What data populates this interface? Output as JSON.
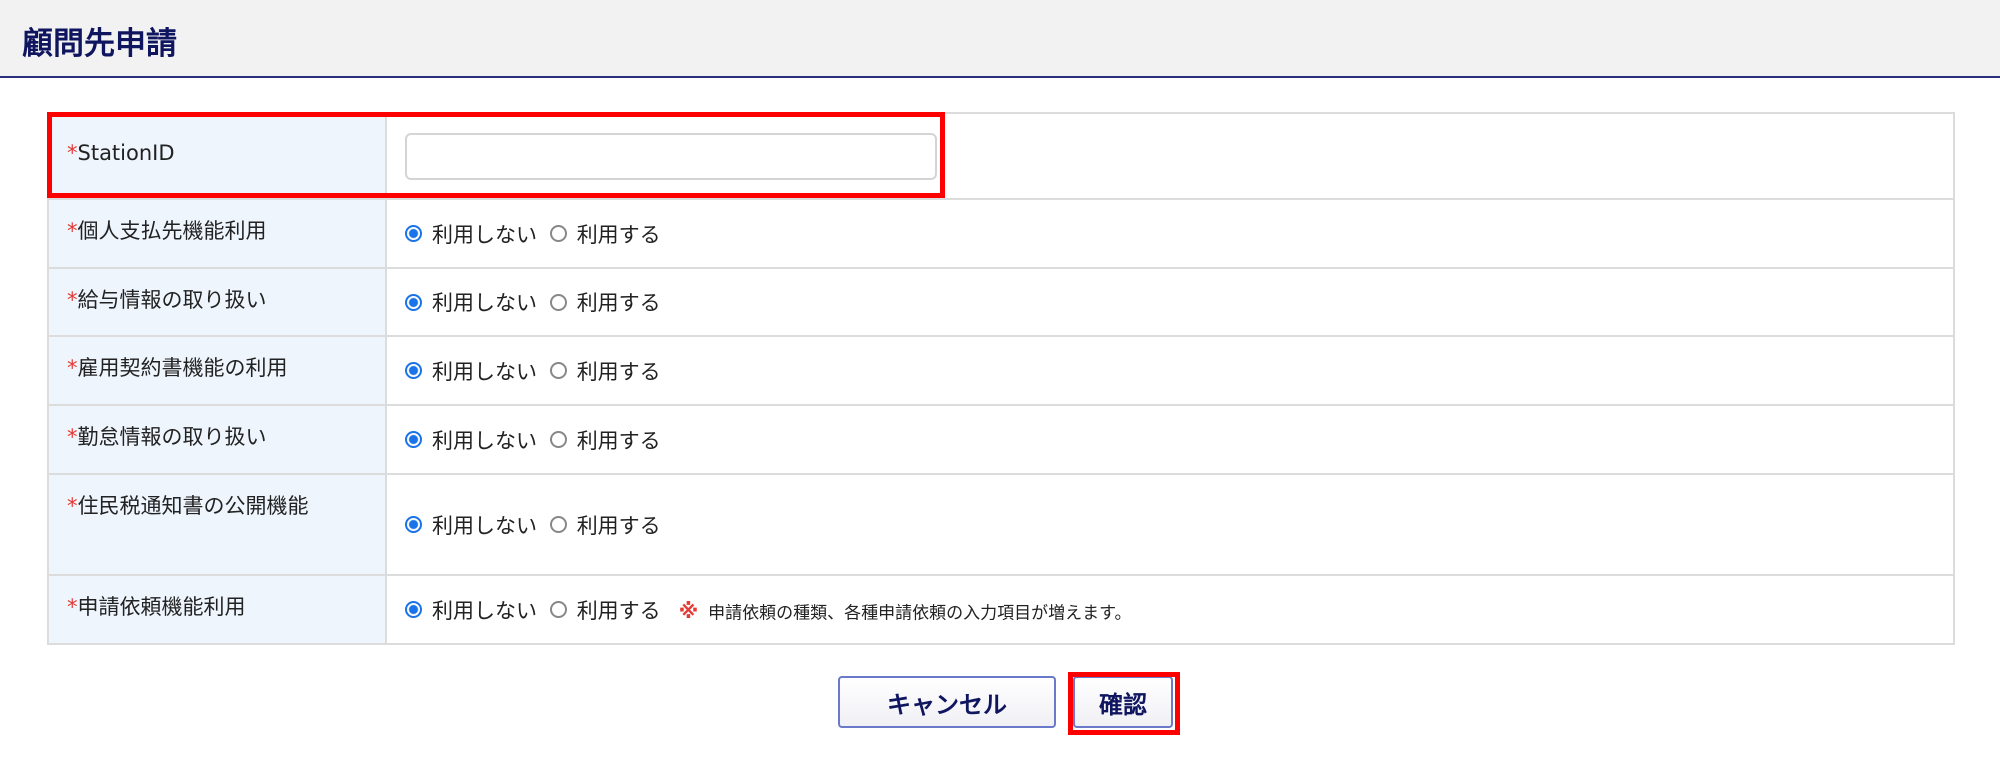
{
  "title": "顧問先申請",
  "station": {
    "label": "StationID",
    "value": ""
  },
  "required_mark": "*",
  "options": {
    "off": "利用しない",
    "on": "利用する"
  },
  "rows": [
    {
      "label": "個人支払先機能利用",
      "selected": "off"
    },
    {
      "label": "給与情報の取り扱い",
      "selected": "off"
    },
    {
      "label": "雇用契約書機能の利用",
      "selected": "off"
    },
    {
      "label": "勤怠情報の取り扱い",
      "selected": "off"
    },
    {
      "label": "住民税通知書の公開機能",
      "selected": "off"
    },
    {
      "label": "申請依頼機能利用",
      "selected": "off"
    }
  ],
  "note": {
    "mark": "※",
    "text": "申請依頼の種類、各種申請依頼の入力項目が増えます。"
  },
  "buttons": {
    "cancel": "キャンセル",
    "confirm": "確認"
  }
}
